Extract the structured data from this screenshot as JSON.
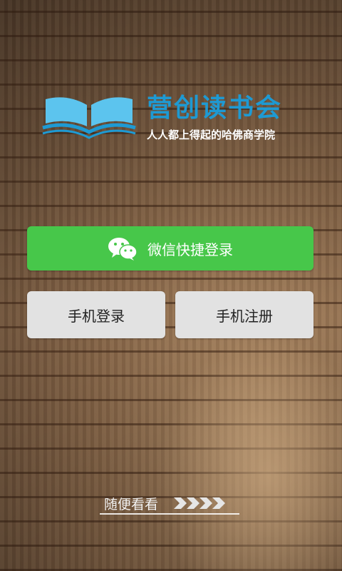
{
  "brand": {
    "title": "营创读书会",
    "slogan": "人人都上得起的哈佛商学院",
    "title_color": "#1e9ad3"
  },
  "buttons": {
    "wechat_login": "微信快捷登录",
    "phone_login": "手机登录",
    "phone_register": "手机注册"
  },
  "browse": {
    "label": "随便看看"
  },
  "icons": {
    "logo": "open-book-icon",
    "wechat": "wechat-icon",
    "browse_arrows": "chevron-right-icon"
  },
  "colors": {
    "wechat_green": "#47c74a",
    "gray_button": "#e2e2e2",
    "logo_blue": "#5cc4ee"
  }
}
